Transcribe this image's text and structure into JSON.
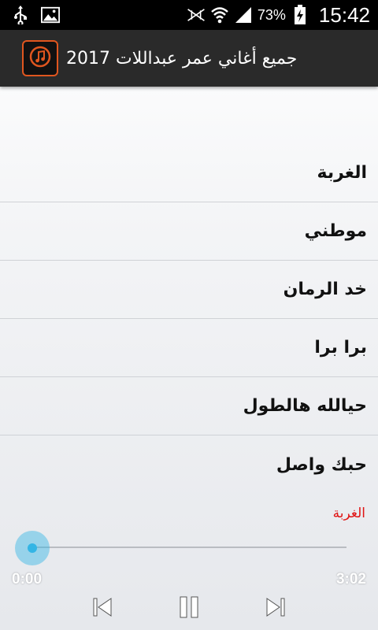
{
  "status_bar": {
    "icons": [
      "usb-icon",
      "image-icon",
      "no-sim-icon",
      "wifi-icon",
      "signal-icon",
      "battery-charging-icon"
    ],
    "battery": "73%",
    "time": "15:42"
  },
  "app_bar": {
    "title": "جميع أغاني عمر عبداللات 2017",
    "logo_icon": "music-note-icon",
    "accent": "#e0561f"
  },
  "songs": [
    {
      "label": "الغربة"
    },
    {
      "label": "موطني"
    },
    {
      "label": "خد الرمان"
    },
    {
      "label": "برا برا"
    },
    {
      "label": "حيالله هالطول"
    },
    {
      "label": "حبك واصل"
    }
  ],
  "player": {
    "now_playing": "الغربة",
    "current_time": "0:00",
    "total_time": "3:02",
    "progress": 0,
    "accent": "#33b5e5",
    "controls": [
      "previous-icon",
      "pause-icon",
      "next-icon"
    ]
  }
}
